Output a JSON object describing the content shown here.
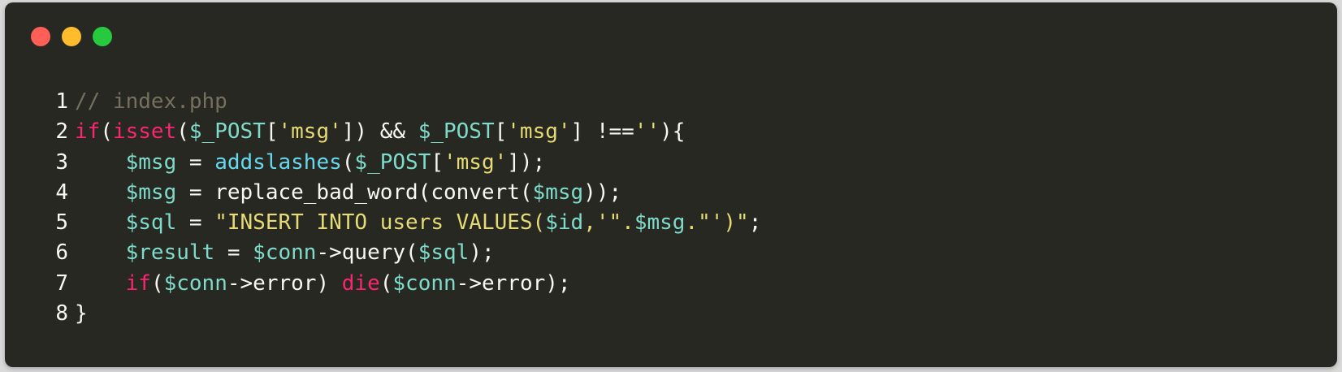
{
  "window": {
    "background": "#272822",
    "traffic_lights": [
      {
        "name": "close-dot",
        "color": "#ff5f56"
      },
      {
        "name": "minimize-dot",
        "color": "#ffbd2e"
      },
      {
        "name": "maximize-dot",
        "color": "#27c93f"
      }
    ]
  },
  "colors": {
    "plain": "#f8f8f2",
    "comment": "#75715e",
    "keyword": "#f92672",
    "function": "#66d9ef",
    "variable": "#a6e22e",
    "var": "#7fdbca",
    "string": "#e6db74"
  },
  "code": {
    "lines": [
      {
        "num": "1",
        "tokens": [
          {
            "t": "// index.php",
            "c": "comment"
          }
        ]
      },
      {
        "num": "2",
        "tokens": [
          {
            "t": "if",
            "c": "keyword"
          },
          {
            "t": "(",
            "c": "plain"
          },
          {
            "t": "isset",
            "c": "keyword"
          },
          {
            "t": "(",
            "c": "plain"
          },
          {
            "t": "$_POST",
            "c": "var"
          },
          {
            "t": "[",
            "c": "plain"
          },
          {
            "t": "'msg'",
            "c": "string"
          },
          {
            "t": "]) && ",
            "c": "plain"
          },
          {
            "t": "$_POST",
            "c": "var"
          },
          {
            "t": "[",
            "c": "plain"
          },
          {
            "t": "'msg'",
            "c": "string"
          },
          {
            "t": "] !==",
            "c": "plain"
          },
          {
            "t": "''",
            "c": "string"
          },
          {
            "t": "){",
            "c": "plain"
          }
        ]
      },
      {
        "num": "3",
        "tokens": [
          {
            "t": "    ",
            "c": "plain"
          },
          {
            "t": "$msg",
            "c": "var"
          },
          {
            "t": " = ",
            "c": "plain"
          },
          {
            "t": "addslashes",
            "c": "function"
          },
          {
            "t": "(",
            "c": "plain"
          },
          {
            "t": "$_POST",
            "c": "var"
          },
          {
            "t": "[",
            "c": "plain"
          },
          {
            "t": "'msg'",
            "c": "string"
          },
          {
            "t": "]);",
            "c": "plain"
          }
        ]
      },
      {
        "num": "4",
        "tokens": [
          {
            "t": "    ",
            "c": "plain"
          },
          {
            "t": "$msg",
            "c": "var"
          },
          {
            "t": " = replace_bad_word(convert(",
            "c": "plain"
          },
          {
            "t": "$msg",
            "c": "var"
          },
          {
            "t": "));",
            "c": "plain"
          }
        ]
      },
      {
        "num": "5",
        "tokens": [
          {
            "t": "    ",
            "c": "plain"
          },
          {
            "t": "$sql",
            "c": "var"
          },
          {
            "t": " = ",
            "c": "plain"
          },
          {
            "t": "\"INSERT INTO users VALUES(",
            "c": "string"
          },
          {
            "t": "$id",
            "c": "var"
          },
          {
            "t": ",'\".",
            "c": "string"
          },
          {
            "t": "$msg",
            "c": "var"
          },
          {
            "t": ".\"')\"",
            "c": "string"
          },
          {
            "t": ";",
            "c": "plain"
          }
        ]
      },
      {
        "num": "6",
        "tokens": [
          {
            "t": "    ",
            "c": "plain"
          },
          {
            "t": "$result",
            "c": "var"
          },
          {
            "t": " = ",
            "c": "plain"
          },
          {
            "t": "$conn",
            "c": "var"
          },
          {
            "t": "->query(",
            "c": "plain"
          },
          {
            "t": "$sql",
            "c": "var"
          },
          {
            "t": ");",
            "c": "plain"
          }
        ]
      },
      {
        "num": "7",
        "tokens": [
          {
            "t": "    ",
            "c": "plain"
          },
          {
            "t": "if",
            "c": "keyword"
          },
          {
            "t": "(",
            "c": "plain"
          },
          {
            "t": "$conn",
            "c": "var"
          },
          {
            "t": "->error) ",
            "c": "plain"
          },
          {
            "t": "die",
            "c": "keyword"
          },
          {
            "t": "(",
            "c": "plain"
          },
          {
            "t": "$conn",
            "c": "var"
          },
          {
            "t": "->error);",
            "c": "plain"
          }
        ]
      },
      {
        "num": "8",
        "tokens": [
          {
            "t": "}",
            "c": "plain"
          }
        ]
      }
    ]
  }
}
